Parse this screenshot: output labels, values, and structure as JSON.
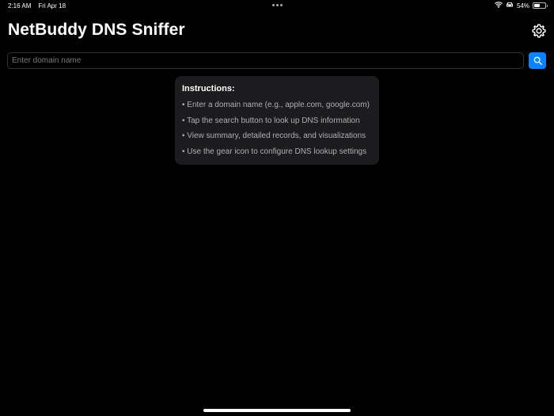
{
  "status_bar": {
    "time": "2:16 AM",
    "date": "Fri Apr 18",
    "battery_percent": "54%",
    "battery_level": 0.54,
    "icons": [
      "wifi-icon",
      "car-icon",
      "battery-icon"
    ]
  },
  "header": {
    "title": "NetBuddy DNS Sniffer",
    "settings_icon": "gear-icon"
  },
  "search": {
    "placeholder": "Enter domain name",
    "value": "",
    "button_icon": "search-icon"
  },
  "instructions": {
    "title": "Instructions:",
    "items": [
      "• Enter a domain name (e.g., apple.com, google.com)",
      "• Tap the search button to look up DNS information",
      "• View summary, detailed records, and visualizations",
      "• Use the gear icon to configure DNS lookup settings"
    ]
  },
  "colors": {
    "background": "#000000",
    "accent": "#0a84ff",
    "card": "#1c1c1e",
    "secondary_text": "#b0b0b0"
  }
}
